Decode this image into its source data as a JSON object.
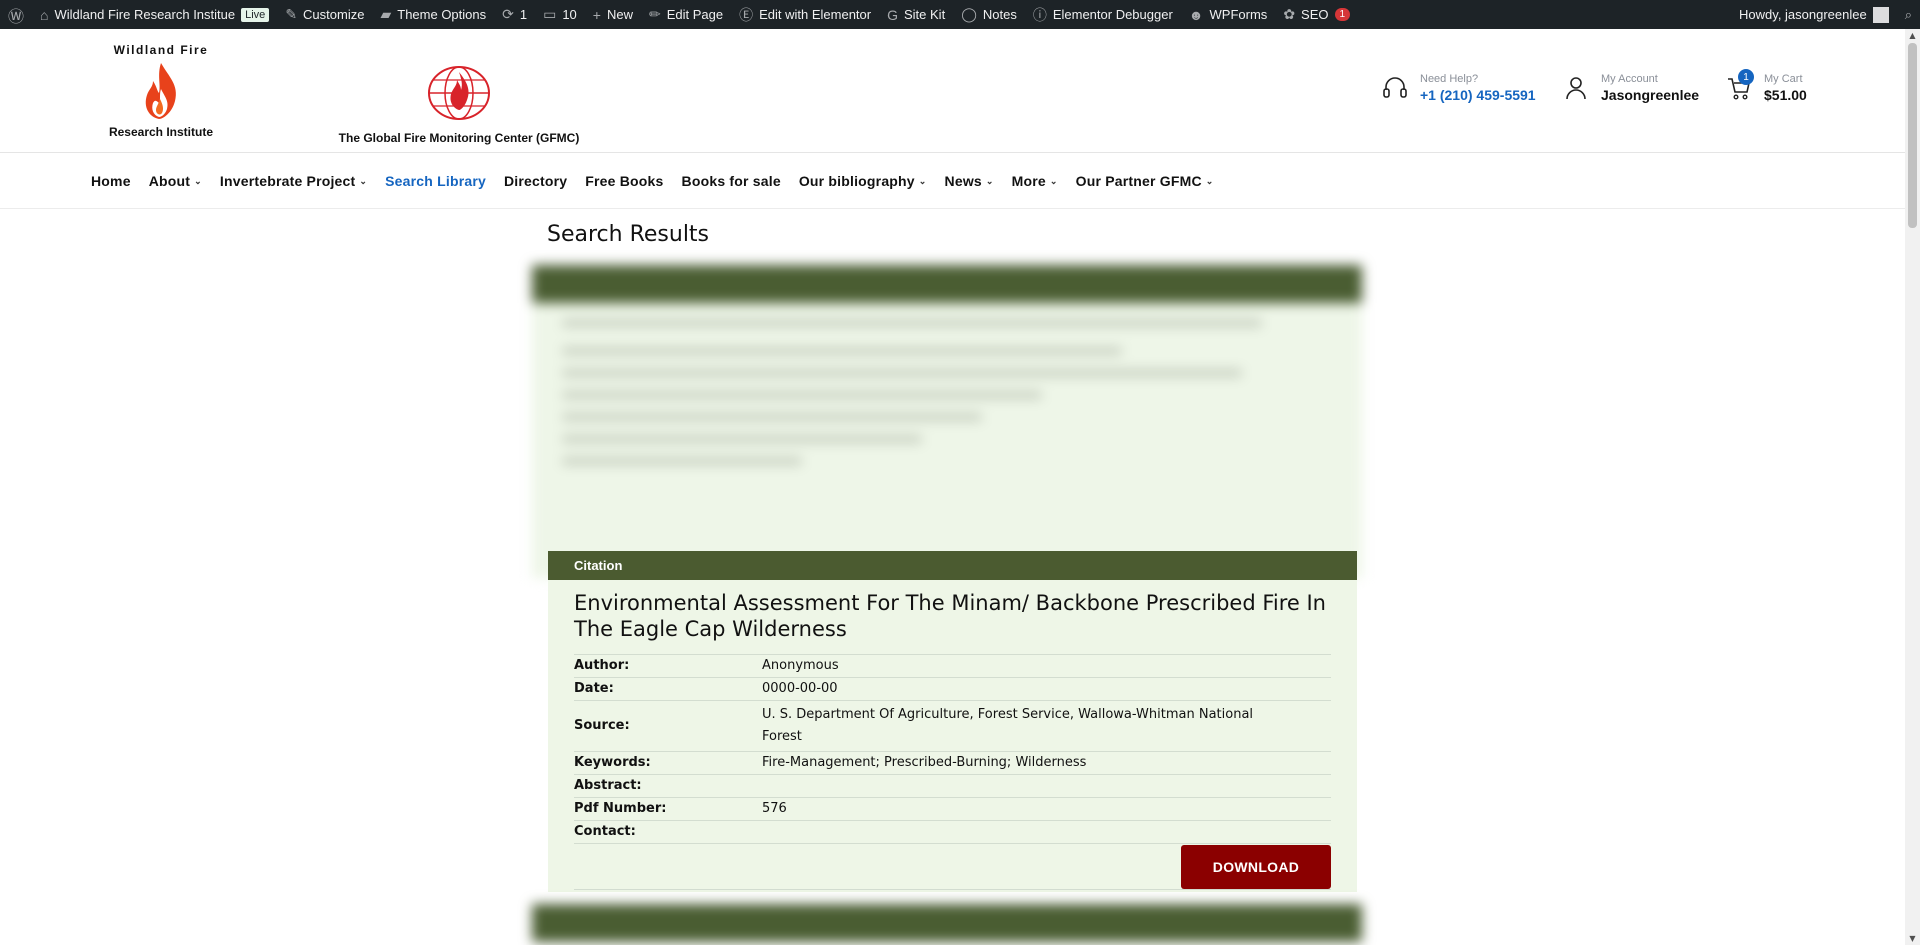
{
  "adminbar": {
    "items": [
      {
        "icon": "wordpress-icon",
        "label": ""
      },
      {
        "icon": "home-icon",
        "label": "Wildland Fire Research Institue",
        "badge": "Live"
      },
      {
        "icon": "brush-icon",
        "label": "Customize"
      },
      {
        "icon": "folder-icon",
        "label": "Theme Options"
      },
      {
        "icon": "refresh-icon",
        "label": "1"
      },
      {
        "icon": "comment-icon",
        "label": "10"
      },
      {
        "icon": "plus-icon",
        "label": "New"
      },
      {
        "icon": "pencil-icon",
        "label": "Edit Page"
      },
      {
        "icon": "elementor-icon",
        "label": "Edit with Elementor"
      },
      {
        "icon": "google-icon",
        "label": "Site Kit"
      },
      {
        "icon": "notes-icon",
        "label": "Notes"
      },
      {
        "icon": "info-icon",
        "label": "Elementor Debugger"
      },
      {
        "icon": "wpforms-icon",
        "label": "WPForms"
      },
      {
        "icon": "seo-icon",
        "label": "SEO",
        "count": "1"
      }
    ],
    "howdy": "Howdy, jasongreenlee"
  },
  "header": {
    "logo_wfri": {
      "line1": "Wildland Fire",
      "line2": "Research Institute"
    },
    "logo_gfmc": {
      "caption": "The Global Fire Monitoring Center (GFMC)"
    },
    "help": {
      "small": "Need Help?",
      "big": "+1 (210) 459-5591"
    },
    "account": {
      "small": "My Account",
      "big": "Jasongreenlee"
    },
    "cart": {
      "small": "My Cart",
      "big": "$51.00",
      "count": "1"
    }
  },
  "nav": {
    "home": "Home",
    "about": "About",
    "invertebrate": "Invertebrate Project",
    "search_library": "Search Library",
    "directory": "Directory",
    "free_books": "Free Books",
    "books_for_sale": "Books for sale",
    "bibliography": "Our bibliography",
    "news": "News",
    "more": "More",
    "partner": "Our Partner GFMC"
  },
  "main": {
    "title": "Search Results",
    "citation": {
      "header": "Citation",
      "title": "Environmental Assessment For The Minam/ Backbone Prescribed Fire In The Eagle Cap Wilderness",
      "rows": [
        {
          "label": "Author:",
          "value": "Anonymous"
        },
        {
          "label": "Date:",
          "value": "0000-00-00"
        },
        {
          "label": "Source:",
          "value": "U. S. Department Of Agriculture, Forest Service, Wallowa-Whitman National Forest"
        },
        {
          "label": "Keywords:",
          "value": "Fire-Management; Prescribed-Burning; Wilderness"
        },
        {
          "label": "Abstract:",
          "value": ""
        },
        {
          "label": "Pdf Number:",
          "value": "576"
        },
        {
          "label": "Contact:",
          "value": ""
        }
      ],
      "download_label": "DOWNLOAD"
    }
  },
  "colors": {
    "accent_blue": "#1565c0",
    "card_header": "#4b5b30",
    "card_bg": "#eef6e7",
    "download_bg": "#8b0000",
    "adminbar_bg": "#1d2327"
  }
}
